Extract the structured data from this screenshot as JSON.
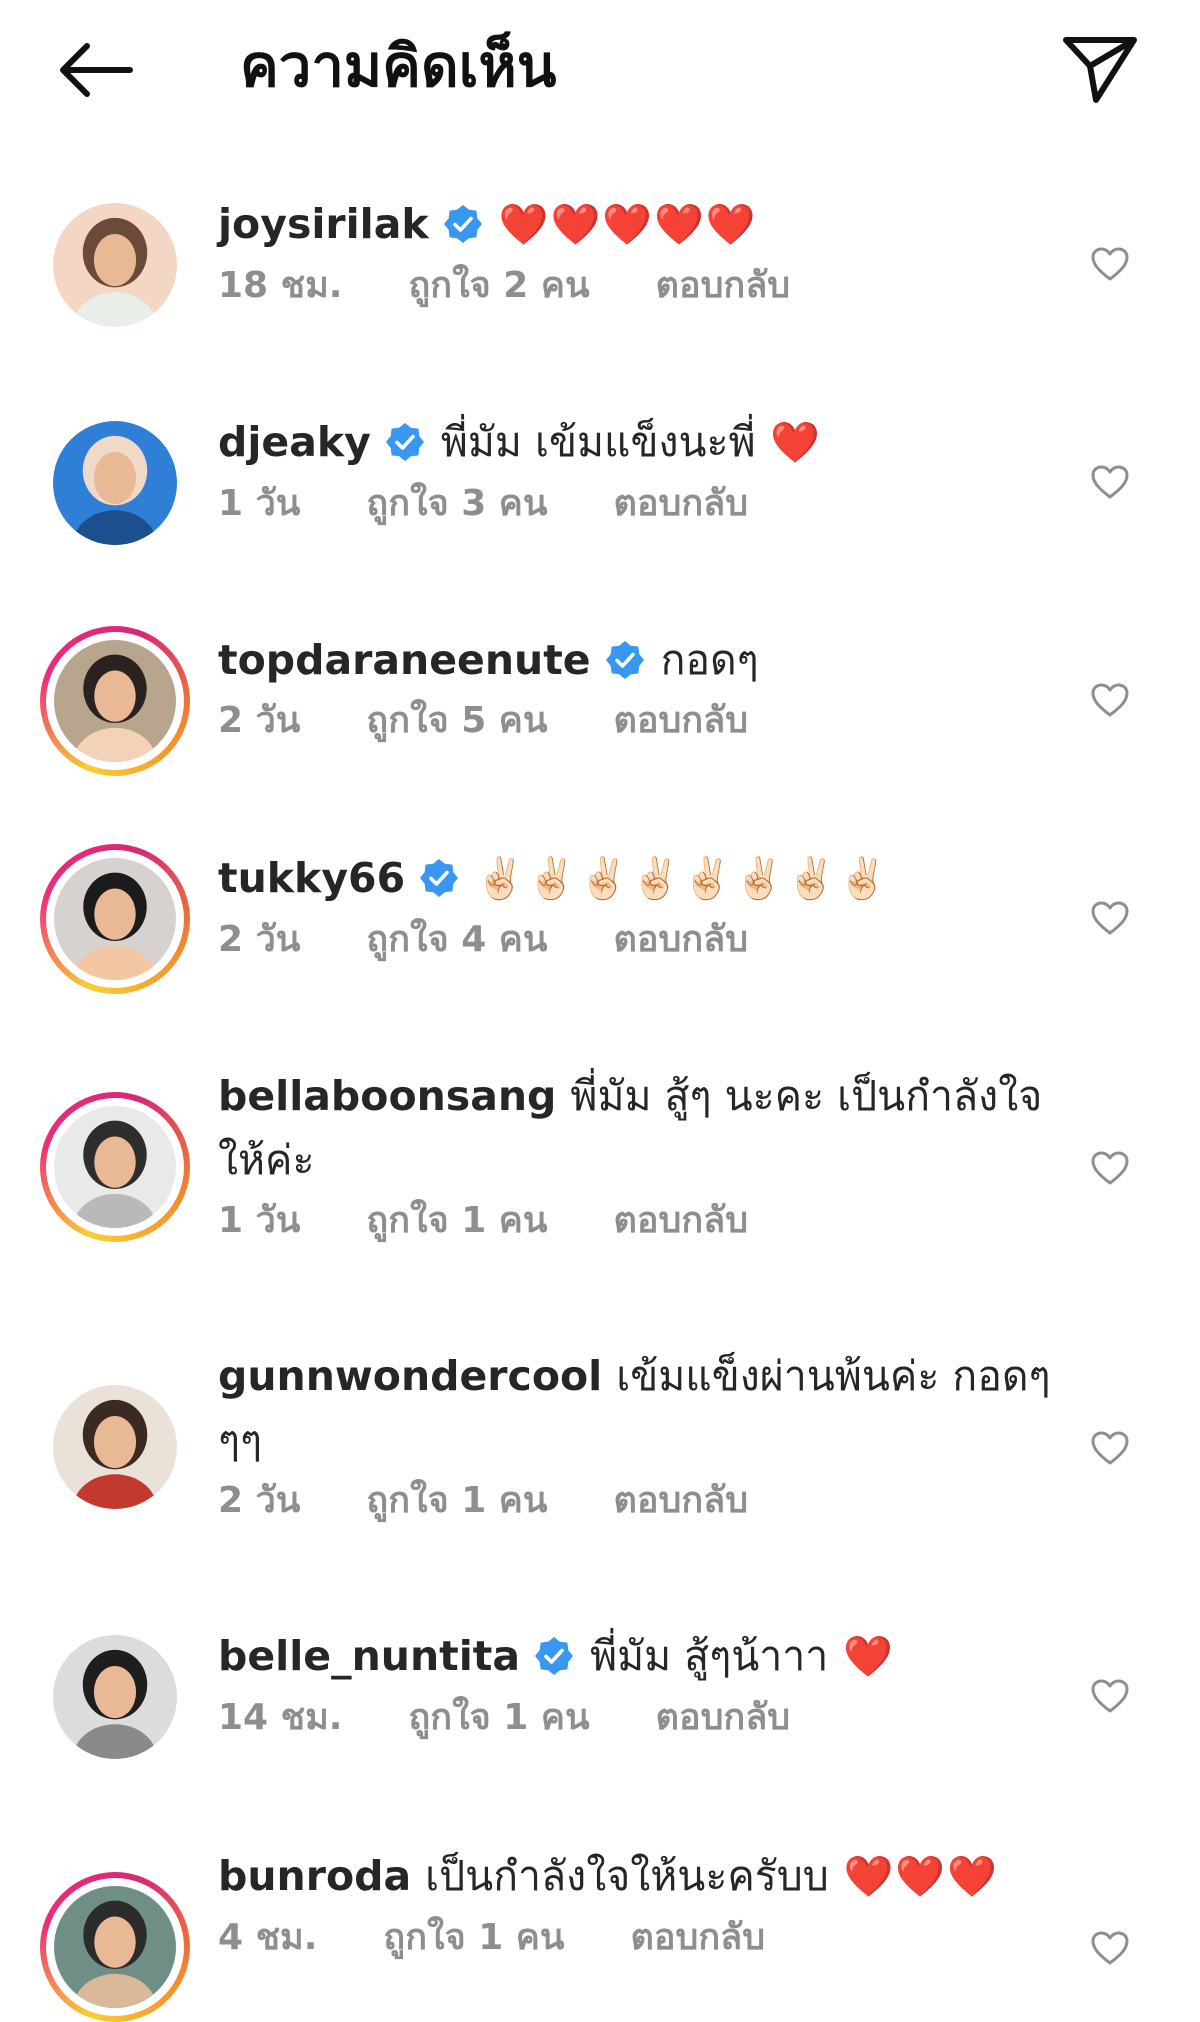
{
  "header": {
    "title": "ความคิดเห็น",
    "back_icon": "arrow-left-icon",
    "send_icon": "paper-plane-icon"
  },
  "colors": {
    "text": "#262626",
    "meta": "#8e8e8e",
    "verified": "#3897f0",
    "heart": "#ed1c3c"
  },
  "comments": [
    {
      "username": "joysirilak",
      "verified": true,
      "text": "",
      "emoji": "❤️❤️❤️❤️❤️",
      "time": "18 ชม.",
      "likes": "ถูกใจ 2 คน",
      "reply": "ตอบกลับ",
      "story_ring": false
    },
    {
      "username": "djeaky",
      "verified": true,
      "text": "พี่มัม เข้มแข็งนะพี่",
      "emoji": "❤️",
      "time": "1 วัน",
      "likes": "ถูกใจ 3 คน",
      "reply": "ตอบกลับ",
      "story_ring": false
    },
    {
      "username": "topdaraneenute",
      "verified": true,
      "text": "กอดๆ",
      "emoji": "",
      "time": "2 วัน",
      "likes": "ถูกใจ 5 คน",
      "reply": "ตอบกลับ",
      "story_ring": true
    },
    {
      "username": "tukky66",
      "verified": true,
      "text": "",
      "emoji": "✌🏻✌🏻✌🏻✌🏻✌🏻✌🏻✌🏻✌🏻",
      "time": "2 วัน",
      "likes": "ถูกใจ 4 คน",
      "reply": "ตอบกลับ",
      "story_ring": true
    },
    {
      "username": "bellaboonsang",
      "verified": false,
      "text": "พี่มัม สู้ๆ นะคะ เป็นกำลังใจให้ค่ะ",
      "emoji": "",
      "time": "1 วัน",
      "likes": "ถูกใจ 1 คน",
      "reply": "ตอบกลับ",
      "story_ring": true
    },
    {
      "username": "gunnwondercool",
      "verified": false,
      "text": "เข้มแข็งผ่านพ้นค่ะ กอดๆๆๆ",
      "emoji": "",
      "time": "2 วัน",
      "likes": "ถูกใจ 1 คน",
      "reply": "ตอบกลับ",
      "story_ring": false
    },
    {
      "username": "belle_nuntita",
      "verified": true,
      "text": "พี่มัม สู้ๆน้าาา",
      "emoji": "❤️",
      "time": "14 ชม.",
      "likes": "ถูกใจ 1 คน",
      "reply": "ตอบกลับ",
      "story_ring": false
    },
    {
      "username": "bunroda",
      "verified": false,
      "text": "เป็นกำลังใจให้นะครับบ",
      "emoji": "❤️❤️❤️",
      "time": "4 ชม.",
      "likes": "ถูกใจ 1 คน",
      "reply": "ตอบกลับ",
      "story_ring": true
    }
  ]
}
